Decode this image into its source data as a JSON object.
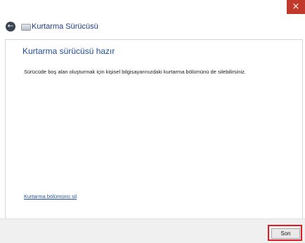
{
  "window": {
    "close_glyph": "×"
  },
  "header": {
    "back_glyph": "←",
    "app_icon": "drive-icon",
    "title": "Kurtarma Sürücüsü"
  },
  "content": {
    "heading": "Kurtarma sürücüsü hazır",
    "description": "Sürücüde boş alan oluşturmak için kişisel bilgisayarınızdaki kurtarma bölümünü de silebilirsiniz.",
    "delete_link": "Kurtarma bölümünü sil"
  },
  "footer": {
    "finish_label": "Son"
  },
  "colors": {
    "accent": "#1f4e9c",
    "close_button": "#c0392b",
    "highlight_outline": "#e01b24"
  }
}
